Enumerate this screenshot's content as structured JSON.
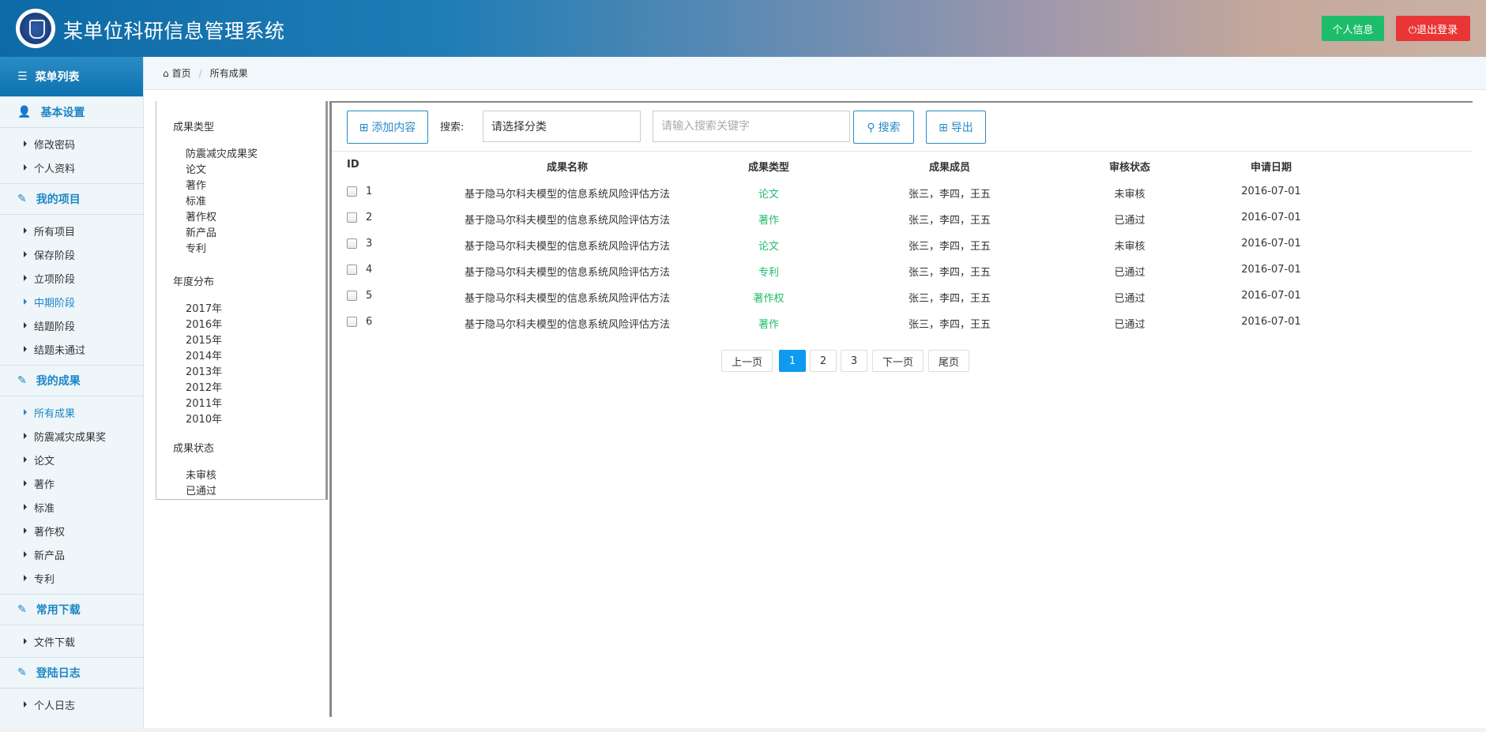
{
  "header": {
    "title": "某单位科研信息管理系统",
    "profile_label": "个人信息",
    "logout_label": "退出登录",
    "logout_icon": "power-icon"
  },
  "sidebar": {
    "head": "菜单列表",
    "groups": [
      {
        "label": "基本设置",
        "icon": "user-icon",
        "items": [
          "修改密码",
          "个人资料"
        ]
      },
      {
        "label": "我的项目",
        "icon": "edit-icon",
        "items": [
          "所有项目",
          "保存阶段",
          "立项阶段",
          "中期阶段",
          "结题阶段",
          "结题未通过"
        ]
      },
      {
        "label": "我的成果",
        "icon": "edit-icon",
        "items": [
          "所有成果",
          "防震减灾成果奖",
          "论文",
          "著作",
          "标准",
          "著作权",
          "新产品",
          "专利"
        ]
      },
      {
        "label": "常用下载",
        "icon": "edit-icon",
        "items": [
          "文件下载"
        ]
      },
      {
        "label": "登陆日志",
        "icon": "edit-icon",
        "items": [
          "个人日志"
        ]
      }
    ],
    "active_items": [
      "中期阶段",
      "所有成果"
    ]
  },
  "breadcrumb": {
    "home": "首页",
    "current": "所有成果"
  },
  "filters": {
    "type_title": "成果类型",
    "types": [
      "防震减灾成果奖",
      "论文",
      "著作",
      "标准",
      "著作权",
      "新产品",
      "专利"
    ],
    "year_title": "年度分布",
    "years": [
      "2017年",
      "2016年",
      "2015年",
      "2014年",
      "2013年",
      "2012年",
      "2011年",
      "2010年"
    ],
    "status_title": "成果状态",
    "statuses": [
      "未审核",
      "已通过"
    ]
  },
  "toolbar": {
    "add_label": "添加内容",
    "search_label": "搜索:",
    "category_value": "请选择分类",
    "keyword_placeholder": "请输入搜索关键字",
    "search_button": "搜索",
    "export_button": "导出"
  },
  "table": {
    "columns": [
      "ID",
      "成果名称",
      "成果类型",
      "成果成员",
      "审核状态",
      "申请日期"
    ],
    "rows": [
      {
        "id": "1",
        "name": "基于隐马尔科夫模型的信息系统风险评估方法",
        "type": "论文",
        "members": "张三，李四，王五",
        "status": "未审核",
        "date": "2016-07-01"
      },
      {
        "id": "2",
        "name": "基于隐马尔科夫模型的信息系统风险评估方法",
        "type": "著作",
        "members": "张三，李四，王五",
        "status": "已通过",
        "date": "2016-07-01"
      },
      {
        "id": "3",
        "name": "基于隐马尔科夫模型的信息系统风险评估方法",
        "type": "论文",
        "members": "张三，李四，王五",
        "status": "未审核",
        "date": "2016-07-01"
      },
      {
        "id": "4",
        "name": "基于隐马尔科夫模型的信息系统风险评估方法",
        "type": "专利",
        "members": "张三，李四，王五",
        "status": "已通过",
        "date": "2016-07-01"
      },
      {
        "id": "5",
        "name": "基于隐马尔科夫模型的信息系统风险评估方法",
        "type": "著作权",
        "members": "张三，李四，王五",
        "status": "已通过",
        "date": "2016-07-01"
      },
      {
        "id": "6",
        "name": "基于隐马尔科夫模型的信息系统风险评估方法",
        "type": "著作",
        "members": "张三，李四，王五",
        "status": "已通过",
        "date": "2016-07-01"
      }
    ]
  },
  "pagination": {
    "prev": "上一页",
    "pages": [
      "1",
      "2",
      "3"
    ],
    "current": "1",
    "next": "下一页",
    "last": "尾页"
  },
  "colors": {
    "accent": "#1e86c6",
    "success": "#1ebd6b",
    "danger": "#e93535",
    "page_active": "#0e9af0"
  }
}
